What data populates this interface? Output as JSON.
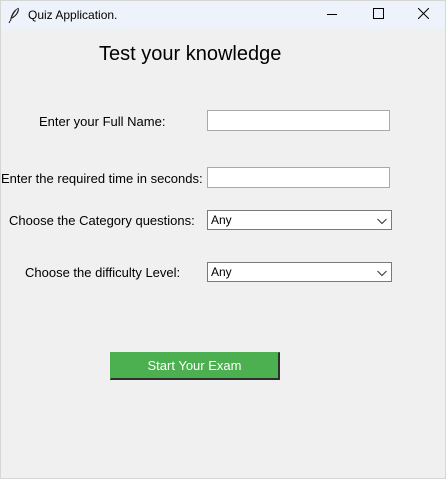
{
  "window": {
    "title": "Quiz Application."
  },
  "titlebar": {
    "icons": [
      "feather-icon",
      "minimize-icon",
      "maximize-icon",
      "close-icon"
    ]
  },
  "main": {
    "heading": "Test your knowledge",
    "name_label": "Enter your Full Name:",
    "name_value": "",
    "time_label": "Enter the required time in seconds:",
    "time_value": "",
    "category_label": "Choose the Category questions:",
    "category_selected": "Any",
    "difficulty_label": "Choose the difficulty Level:",
    "difficulty_selected": "Any",
    "start_button": "Start Your Exam"
  },
  "colors": {
    "background": "#f0f0f0",
    "titlebar": "#eef2fa",
    "button_green": "#4caf50",
    "button_text": "#ffffff"
  }
}
